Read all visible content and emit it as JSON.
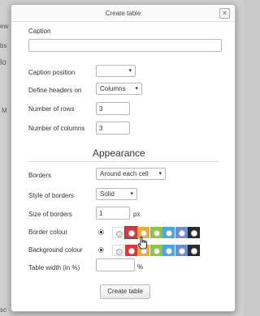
{
  "background": {
    "fragments": [
      "ew",
      "bs",
      "lo",
      "M",
      "sc"
    ]
  },
  "dialog": {
    "title": "Create table",
    "close_label": "×"
  },
  "form": {
    "caption_label": "Caption",
    "caption_value": "",
    "caption_position_label": "Caption position",
    "caption_position_value": "",
    "define_headers_label": "Define headers on",
    "define_headers_value": "Columns",
    "rows_label": "Number of rows",
    "rows_value": "3",
    "columns_label": "Number of columns",
    "columns_value": "3",
    "appearance_title": "Appearance",
    "borders_label": "Borders",
    "borders_value": "Around each cell",
    "border_style_label": "Style of borders",
    "border_style_value": "Solid",
    "border_size_label": "Size of borders",
    "border_size_value": "1",
    "border_size_unit": "px",
    "border_colour_label": "Border colour",
    "background_colour_label": "Background colour",
    "table_width_label": "Table width (in %)",
    "table_width_value": "",
    "table_width_unit": "%",
    "submit_label": "Create table"
  },
  "colours": [
    "#ffffff",
    "#d9363e",
    "#f0ad2c",
    "#8dc63f",
    "#4aa8de",
    "#6d8fcf",
    "#2a2a2a"
  ],
  "selected_border_colour": 1,
  "icons": {
    "caret": "chevron-down-icon",
    "cursor": "hand-pointer-icon"
  }
}
